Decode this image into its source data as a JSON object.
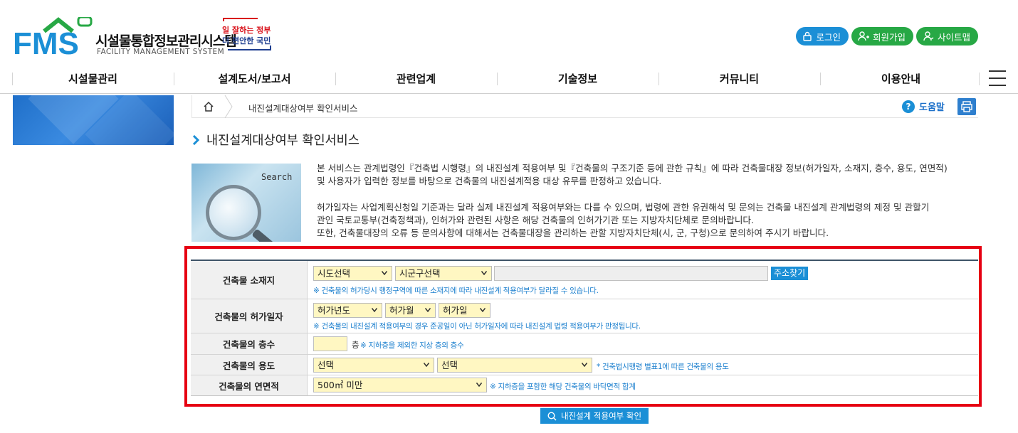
{
  "header": {
    "logo_letters": "FMS",
    "logo_title": "시설물통합정보관리시스템",
    "logo_subtitle": "FACILITY MANAGEMENT SYSTEM",
    "badge_line1": "일 잘하는 정부",
    "badge_line2": "더 편안한 국민",
    "buttons": [
      {
        "label": "로그인",
        "icon": "lock-icon"
      },
      {
        "label": "회원가입",
        "icon": "add-user-icon"
      },
      {
        "label": "사이트맵",
        "icon": "sitemap-user-icon"
      }
    ]
  },
  "nav": {
    "items": [
      "시설물관리",
      "설계도서/보고서",
      "관련업계",
      "기술정보",
      "커뮤니티",
      "이용안내"
    ]
  },
  "breadcrumb": {
    "current": "내진설계대상여부 확인서비스",
    "help_label": "도움말"
  },
  "page": {
    "title": "내진설계대상여부 확인서비스",
    "search_image_label": "Search",
    "intro": [
      "본 서비스는 관계법령인『건축법 시행령』의 내진설계 적용여부 및『건축물의 구조기준 등에 관한 규칙』에 따라 건축물대장 정보(허가일자, 소재지, 층수, 용도, 연면적)",
      "및 사용자가 입력한 정보를 바탕으로 건축물의 내진설계적용 대상 유무를 판정하고 있습니다.",
      "허가일자는 사업계획신청일 기준과는 달라 실제 내진설계 적용여부와는 다를 수 있으며, 법령에 관한 유권해석 및 문의는 건축물 내진설계 관계법령의 제정 및 관할기",
      "관인 국토교통부(건축정책과), 인허가와 관련된 사항은 해당 건축물의 인허가기관 또는 지방자치단체로 문의바랍니다.",
      "또한, 건축물대장의 오류 등 문의사항에 대해서는 건축물대장을 관리하는 관할 지방자치단체(시, 군, 구청)으로 문의하여 주시기 바랍니다."
    ]
  },
  "form": {
    "location": {
      "label": "건축물 소재지",
      "sido": "시도선택",
      "sigungu": "시군구선택",
      "address_value": "",
      "search_button": "주소찾기",
      "note": "※ 건축물의 허가당시 행정구역에 따른 소재지에 따라 내진설계 적용여부가 달라질 수 있습니다."
    },
    "permit_date": {
      "label": "건축물의 허가일자",
      "year": "허가년도",
      "month": "허가월",
      "day": "허가일",
      "note": "※ 건축물의 내진설계 적용여부의 경우 준공일이 아닌 허가일자에 따라 내진설계 법령 적용여부가 판정됩니다."
    },
    "floors": {
      "label": "건축물의 층수",
      "value": "",
      "unit": "층",
      "note": "※ 지하층을 제외한 지상 층의 층수"
    },
    "usage": {
      "label": "건축물의 용도",
      "primary": "선택",
      "secondary": "선택",
      "note": "* 건축법시행령 별표1에 따른 건축물의 용도"
    },
    "area": {
      "label": "건축물의 연면적",
      "value": "500㎡ 미만",
      "note": "※ 지하층을 포함한 해당 건축물의 바닥면적 합계"
    },
    "confirm_button": "내진설계 적용여부 확인"
  },
  "colors": {
    "accent_blue": "#1b8fd6",
    "accent_green": "#27a845",
    "highlight_red": "#e60012",
    "select_yellow": "#fff7c2"
  }
}
